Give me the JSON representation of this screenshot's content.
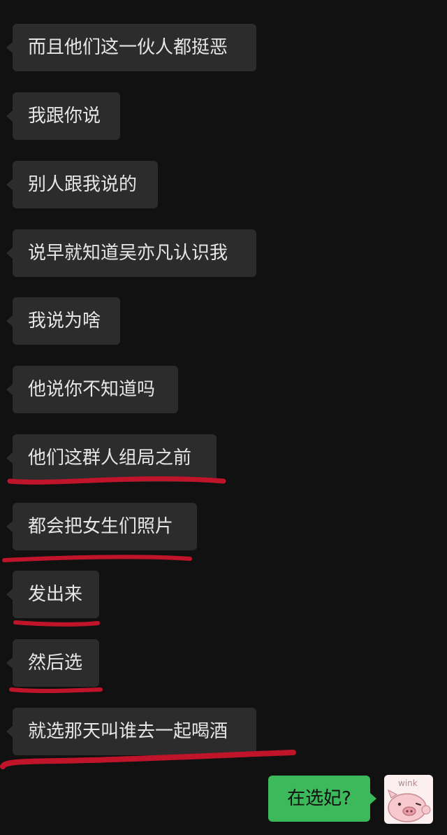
{
  "messages": [
    {
      "text": "而且他们这一伙人都挺恶"
    },
    {
      "text": "我跟你说"
    },
    {
      "text": "别人跟我说的"
    },
    {
      "text": "说早就知道吴亦凡认识我"
    },
    {
      "text": "我说为啥"
    },
    {
      "text": "他说你不知道吗"
    },
    {
      "text": "他们这群人组局之前"
    },
    {
      "text": "都会把女生们照片"
    },
    {
      "text": "发出来"
    },
    {
      "text": "然后选"
    },
    {
      "text": "就选那天叫谁去一起喝酒"
    }
  ],
  "outgoing": {
    "text": "在选妃?"
  },
  "avatar": {
    "sticker_text": "wink",
    "icon": "pig-face-icon"
  },
  "colors": {
    "background": "#111111",
    "incoming_bubble": "#2c2c2c",
    "outgoing_bubble": "#3cb95a",
    "underline": "#c0142a"
  }
}
